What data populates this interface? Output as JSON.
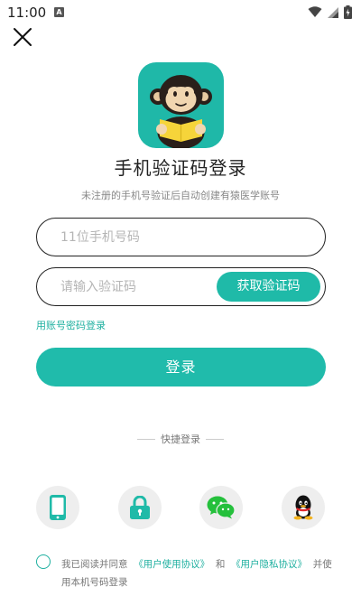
{
  "status_bar": {
    "time": "11:00",
    "notification_letter": "A"
  },
  "header": {
    "title": "手机验证码登录",
    "subtitle": "未注册的手机号验证后自动创建有猿医学账号"
  },
  "form": {
    "phone_placeholder": "11位手机号码",
    "code_placeholder": "请输入验证码",
    "get_code_label": "获取验证码",
    "password_login_link": "用账号密码登录",
    "login_label": "登录"
  },
  "quick_login": {
    "label": "快捷登录",
    "options": [
      "phone-icon",
      "lock-icon",
      "wechat-icon",
      "qq-icon"
    ]
  },
  "agreement": {
    "prefix": "我已阅读并同意",
    "user_agreement": "《用户使用协议》",
    "and": "和",
    "privacy_policy": "《用户隐私协议》",
    "suffix": "并使用本机号码登录"
  },
  "colors": {
    "accent": "#1fbaa8",
    "text": "#222222",
    "muted": "#888888"
  }
}
